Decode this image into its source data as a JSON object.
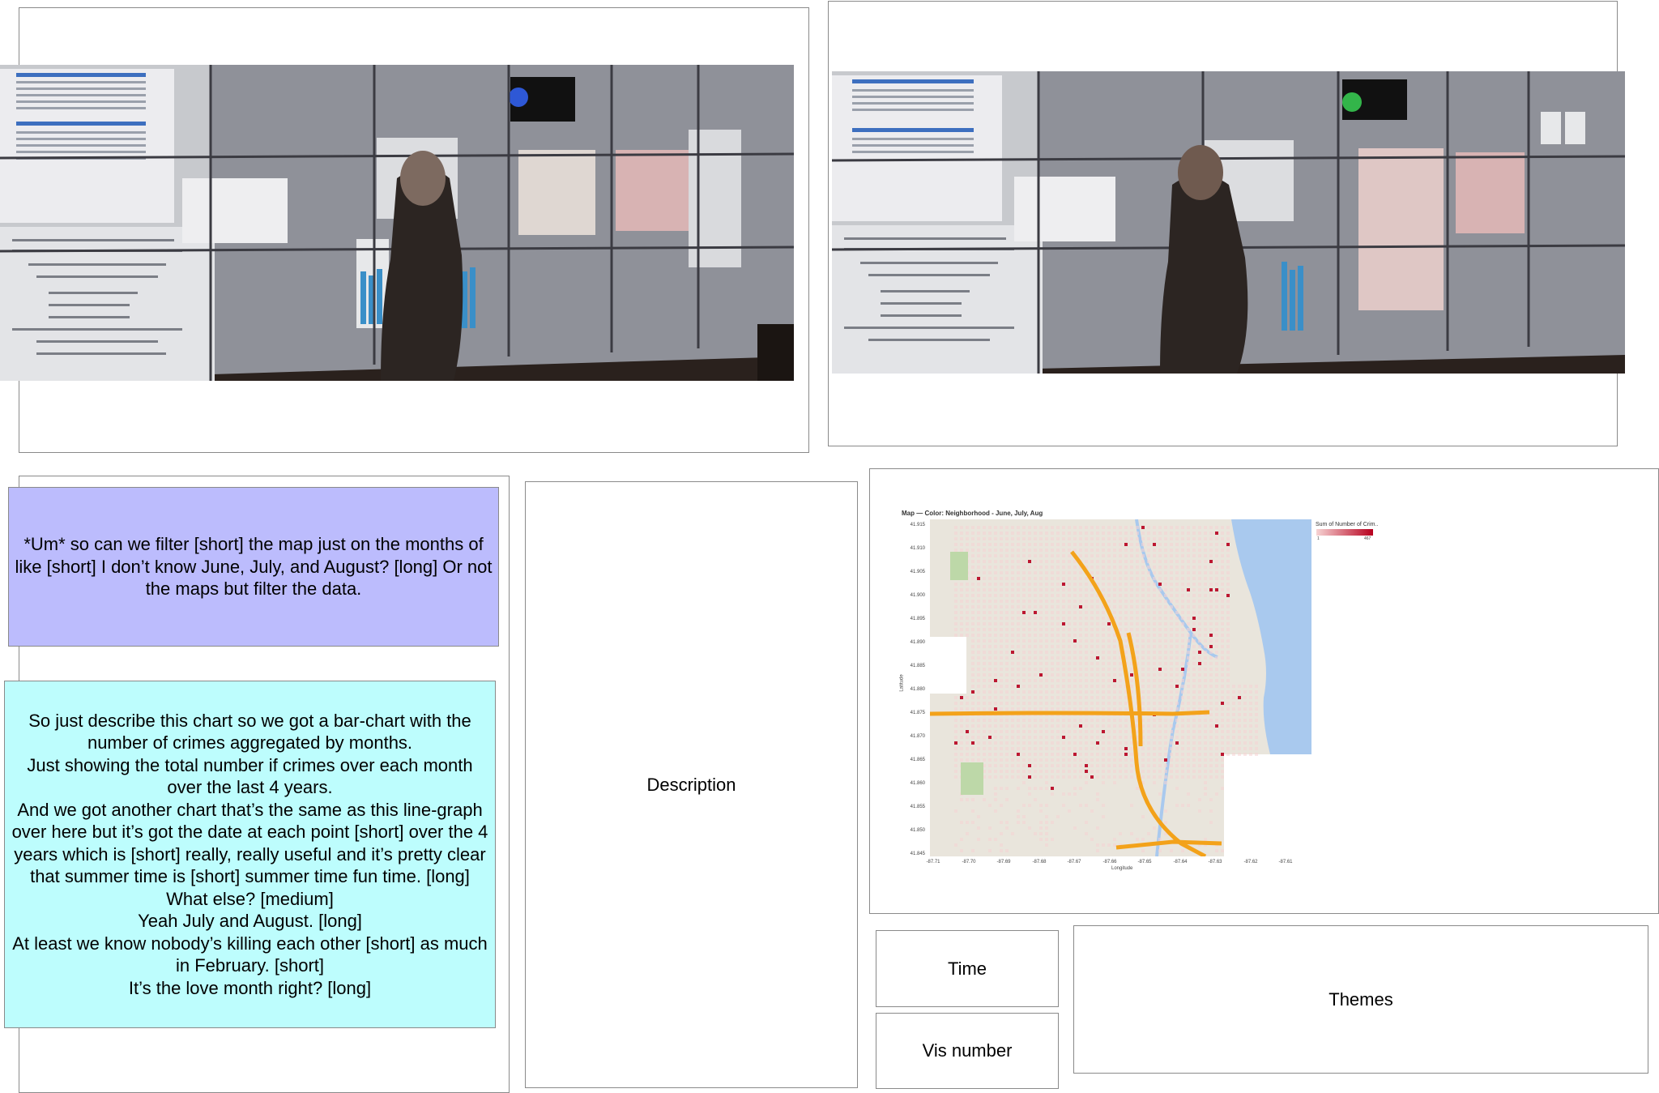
{
  "quote": {
    "text": "*Um* so can we filter [short] the map just on the months of like [short] I don’t know June, July, and August? [long] Or not the maps but filter the data."
  },
  "transcript": {
    "lines": [
      "So just describe this chart so we got a bar-chart with the number of crimes aggregated by months.",
      "Just showing the total number if crimes over each month over the last 4 years.",
      "And we got another chart that’s the same as this line-graph over here but it’s got the date at each point [short] over the 4 years which is [short] really, really useful and it’s pretty clear that summer time is [short] summer time fun time. [long]",
      "What else? [medium]",
      "Yeah July and August. [long]",
      "At least we know nobody’s killing each other [short] as much in February. [short]",
      "It’s the love month right? [long]"
    ]
  },
  "labels": {
    "description": "Description",
    "time": "Time",
    "vis_number": "Vis number",
    "themes": "Themes"
  },
  "map": {
    "title": "Map — Color: Neighborhood  - June, July, Aug",
    "y_axis_label": "Latitude",
    "x_axis_label": "Longitude",
    "y_ticks": [
      "41.915",
      "41.910",
      "41.905",
      "41.900",
      "41.895",
      "41.890",
      "41.885",
      "41.880",
      "41.875",
      "41.870",
      "41.865",
      "41.860",
      "41.855",
      "41.850",
      "41.845"
    ],
    "x_ticks": [
      "-87.71",
      "-87.70",
      "-87.69",
      "-87.68",
      "-87.67",
      "-87.66",
      "-87.65",
      "-87.64",
      "-87.63",
      "-87.62",
      "-87.61"
    ],
    "legend_title": "Sum of Number of Crim..",
    "legend_min": "1",
    "legend_max": "467",
    "colors": {
      "low": "#f6d3d3",
      "high": "#b7001e",
      "water": "#a9c9ee",
      "highway": "#f3a21a",
      "land": "#e9e5dc"
    }
  },
  "photos": {
    "left": {
      "description_text": "ask Description.png",
      "task_heading": "Your task"
    },
    "right": {
      "description_text": "ask Description.png",
      "task_heading": "Your task"
    }
  }
}
